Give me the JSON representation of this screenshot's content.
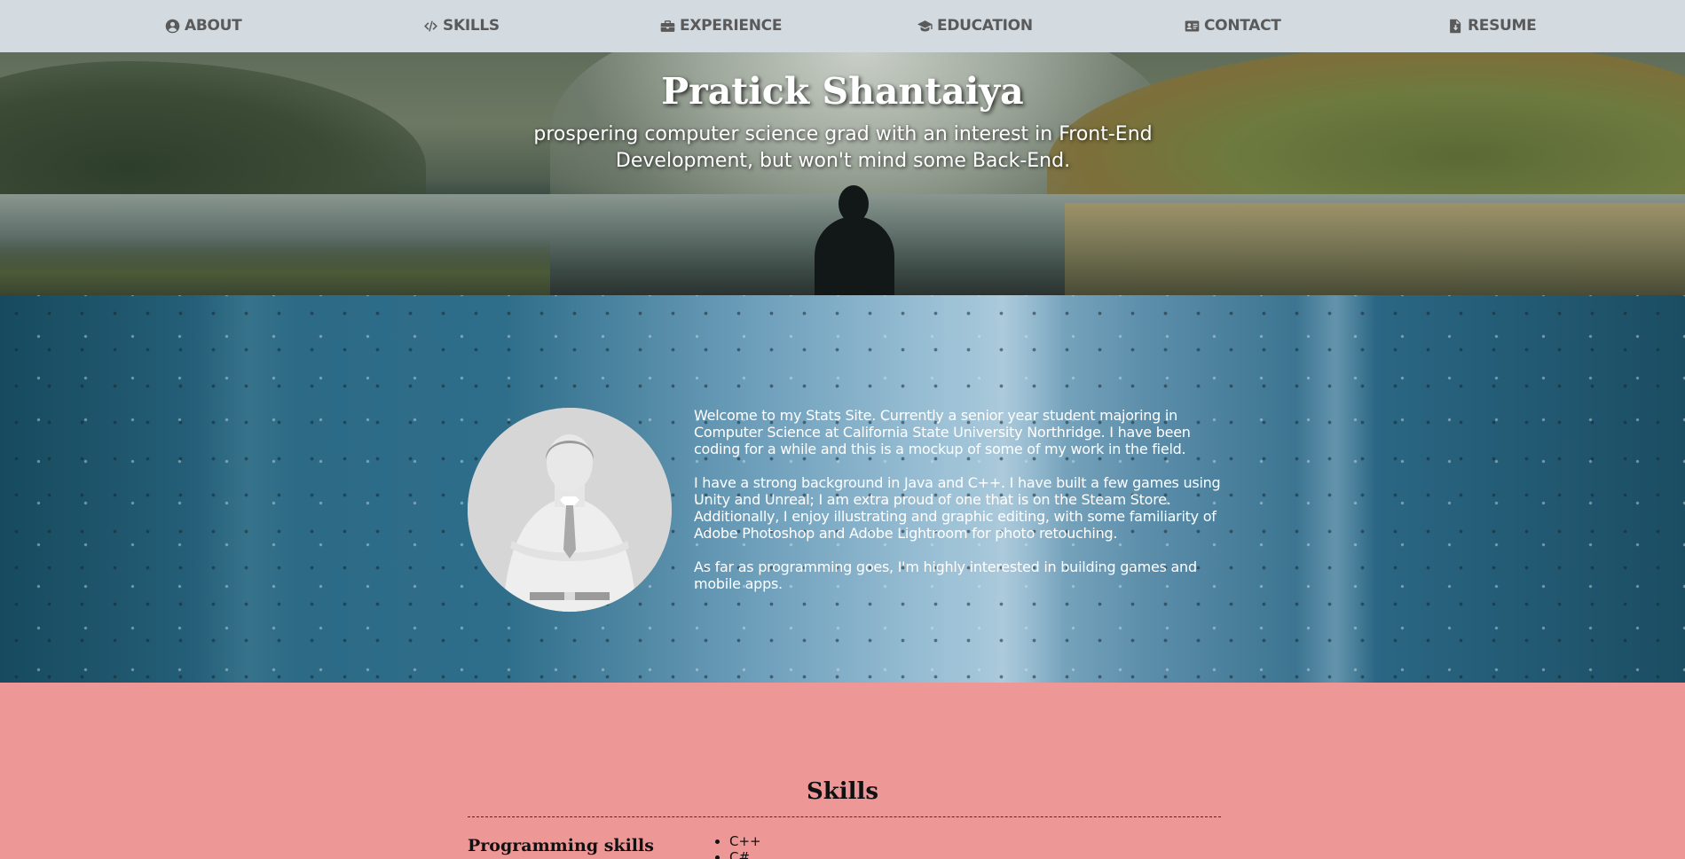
{
  "nav": {
    "items": [
      {
        "label": "ABOUT",
        "icon": "user-circle-icon"
      },
      {
        "label": "SKILLS",
        "icon": "code-icon"
      },
      {
        "label": "EXPERIENCE",
        "icon": "briefcase-icon"
      },
      {
        "label": "EDUCATION",
        "icon": "graduation-cap-icon"
      },
      {
        "label": "CONTACT",
        "icon": "address-card-icon"
      },
      {
        "label": "RESUME",
        "icon": "file-download-icon"
      }
    ]
  },
  "hero": {
    "title": "Pratick Shantaiya",
    "subtitle": "prospering computer science grad with an interest in Front-End Development, but won't mind some Back-End."
  },
  "about": {
    "paragraphs": [
      "Welcome to my Stats Site. Currently a senior year student majoring in Computer Science at California State University Northridge. I have been coding for a while and this is a mockup of some of my work in the field.",
      "I have a strong background in Java and C++. I have built a few games using Unity and Unreal; I am extra proud of one that is on the Steam Store. Additionally, I enjoy illustrating and graphic editing, with some familiarity of Adobe Photoshop and Adobe Lightroom for photo retouching.",
      "As far as programming goes, I'm highly interested in building games and mobile apps."
    ]
  },
  "skills": {
    "title": "Skills",
    "category": "Programming skills",
    "items": [
      "C++",
      "C#"
    ]
  },
  "colors": {
    "nav_bg": "#d3dbe1",
    "nav_text": "#5a5a5a",
    "skills_bg": "#ed9797"
  }
}
